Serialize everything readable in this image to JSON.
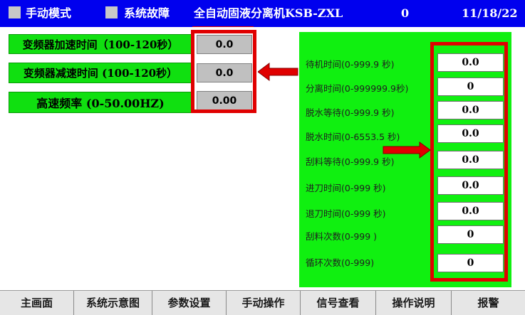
{
  "header": {
    "mode_label": "手动模式",
    "fault_label": "系统故障",
    "machine_title": "全自动固液分离机KSB-ZXL",
    "counter": "0",
    "date": "11/18/22"
  },
  "left_params": [
    {
      "label": "变频器加速时间（100-120秒）",
      "value": "0.0"
    },
    {
      "label": "变频器减速时间 (100-120秒）",
      "value": "0.0"
    },
    {
      "label": "高速频率 (0-50.00HZ)",
      "value": "0.00"
    }
  ],
  "right_params": [
    {
      "label": "待机时间(0-999.9 秒)",
      "value": "0.0"
    },
    {
      "label": "分离时间(0-999999.9秒)",
      "value": "0"
    },
    {
      "label": "脱水等待(0-999.9 秒)",
      "value": "0.0"
    },
    {
      "label": "脱水时间(0-6553.5 秒)",
      "value": "0.0"
    },
    {
      "label": "刮料等待(0-999.9 秒)",
      "value": "0.0"
    },
    {
      "label": "进刀时间(0-999 秒)",
      "value": "0.0"
    },
    {
      "label": "退刀时间(0-999 秒)",
      "value": "0.0"
    },
    {
      "label": "刮料次数(0-999 )",
      "value": "0"
    },
    {
      "label": "循环次数(0-999)",
      "value": "0"
    }
  ],
  "nav": [
    "主画面",
    "系统示意图",
    "参数设置",
    "手动操作",
    "信号查看",
    "操作说明",
    "报警"
  ],
  "colors": {
    "header_bg": "#0000ee",
    "panel_green": "#10f010",
    "label_green": "#10e010",
    "highlight_red": "#e00000",
    "nav_bg": "#e6e6e6"
  }
}
